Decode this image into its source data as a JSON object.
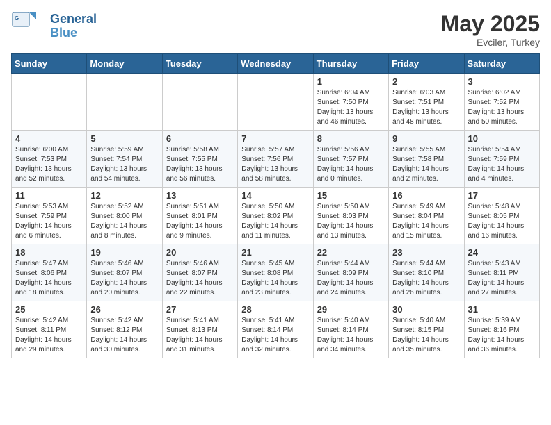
{
  "header": {
    "logo_general": "General",
    "logo_blue": "Blue",
    "month": "May 2025",
    "location": "Evciler, Turkey"
  },
  "weekdays": [
    "Sunday",
    "Monday",
    "Tuesday",
    "Wednesday",
    "Thursday",
    "Friday",
    "Saturday"
  ],
  "weeks": [
    [
      {
        "day": "",
        "info": ""
      },
      {
        "day": "",
        "info": ""
      },
      {
        "day": "",
        "info": ""
      },
      {
        "day": "",
        "info": ""
      },
      {
        "day": "1",
        "info": "Sunrise: 6:04 AM\nSunset: 7:50 PM\nDaylight: 13 hours\nand 46 minutes."
      },
      {
        "day": "2",
        "info": "Sunrise: 6:03 AM\nSunset: 7:51 PM\nDaylight: 13 hours\nand 48 minutes."
      },
      {
        "day": "3",
        "info": "Sunrise: 6:02 AM\nSunset: 7:52 PM\nDaylight: 13 hours\nand 50 minutes."
      }
    ],
    [
      {
        "day": "4",
        "info": "Sunrise: 6:00 AM\nSunset: 7:53 PM\nDaylight: 13 hours\nand 52 minutes."
      },
      {
        "day": "5",
        "info": "Sunrise: 5:59 AM\nSunset: 7:54 PM\nDaylight: 13 hours\nand 54 minutes."
      },
      {
        "day": "6",
        "info": "Sunrise: 5:58 AM\nSunset: 7:55 PM\nDaylight: 13 hours\nand 56 minutes."
      },
      {
        "day": "7",
        "info": "Sunrise: 5:57 AM\nSunset: 7:56 PM\nDaylight: 13 hours\nand 58 minutes."
      },
      {
        "day": "8",
        "info": "Sunrise: 5:56 AM\nSunset: 7:57 PM\nDaylight: 14 hours\nand 0 minutes."
      },
      {
        "day": "9",
        "info": "Sunrise: 5:55 AM\nSunset: 7:58 PM\nDaylight: 14 hours\nand 2 minutes."
      },
      {
        "day": "10",
        "info": "Sunrise: 5:54 AM\nSunset: 7:59 PM\nDaylight: 14 hours\nand 4 minutes."
      }
    ],
    [
      {
        "day": "11",
        "info": "Sunrise: 5:53 AM\nSunset: 7:59 PM\nDaylight: 14 hours\nand 6 minutes."
      },
      {
        "day": "12",
        "info": "Sunrise: 5:52 AM\nSunset: 8:00 PM\nDaylight: 14 hours\nand 8 minutes."
      },
      {
        "day": "13",
        "info": "Sunrise: 5:51 AM\nSunset: 8:01 PM\nDaylight: 14 hours\nand 9 minutes."
      },
      {
        "day": "14",
        "info": "Sunrise: 5:50 AM\nSunset: 8:02 PM\nDaylight: 14 hours\nand 11 minutes."
      },
      {
        "day": "15",
        "info": "Sunrise: 5:50 AM\nSunset: 8:03 PM\nDaylight: 14 hours\nand 13 minutes."
      },
      {
        "day": "16",
        "info": "Sunrise: 5:49 AM\nSunset: 8:04 PM\nDaylight: 14 hours\nand 15 minutes."
      },
      {
        "day": "17",
        "info": "Sunrise: 5:48 AM\nSunset: 8:05 PM\nDaylight: 14 hours\nand 16 minutes."
      }
    ],
    [
      {
        "day": "18",
        "info": "Sunrise: 5:47 AM\nSunset: 8:06 PM\nDaylight: 14 hours\nand 18 minutes."
      },
      {
        "day": "19",
        "info": "Sunrise: 5:46 AM\nSunset: 8:07 PM\nDaylight: 14 hours\nand 20 minutes."
      },
      {
        "day": "20",
        "info": "Sunrise: 5:46 AM\nSunset: 8:07 PM\nDaylight: 14 hours\nand 22 minutes."
      },
      {
        "day": "21",
        "info": "Sunrise: 5:45 AM\nSunset: 8:08 PM\nDaylight: 14 hours\nand 23 minutes."
      },
      {
        "day": "22",
        "info": "Sunrise: 5:44 AM\nSunset: 8:09 PM\nDaylight: 14 hours\nand 24 minutes."
      },
      {
        "day": "23",
        "info": "Sunrise: 5:44 AM\nSunset: 8:10 PM\nDaylight: 14 hours\nand 26 minutes."
      },
      {
        "day": "24",
        "info": "Sunrise: 5:43 AM\nSunset: 8:11 PM\nDaylight: 14 hours\nand 27 minutes."
      }
    ],
    [
      {
        "day": "25",
        "info": "Sunrise: 5:42 AM\nSunset: 8:11 PM\nDaylight: 14 hours\nand 29 minutes."
      },
      {
        "day": "26",
        "info": "Sunrise: 5:42 AM\nSunset: 8:12 PM\nDaylight: 14 hours\nand 30 minutes."
      },
      {
        "day": "27",
        "info": "Sunrise: 5:41 AM\nSunset: 8:13 PM\nDaylight: 14 hours\nand 31 minutes."
      },
      {
        "day": "28",
        "info": "Sunrise: 5:41 AM\nSunset: 8:14 PM\nDaylight: 14 hours\nand 32 minutes."
      },
      {
        "day": "29",
        "info": "Sunrise: 5:40 AM\nSunset: 8:14 PM\nDaylight: 14 hours\nand 34 minutes."
      },
      {
        "day": "30",
        "info": "Sunrise: 5:40 AM\nSunset: 8:15 PM\nDaylight: 14 hours\nand 35 minutes."
      },
      {
        "day": "31",
        "info": "Sunrise: 5:39 AM\nSunset: 8:16 PM\nDaylight: 14 hours\nand 36 minutes."
      }
    ]
  ]
}
